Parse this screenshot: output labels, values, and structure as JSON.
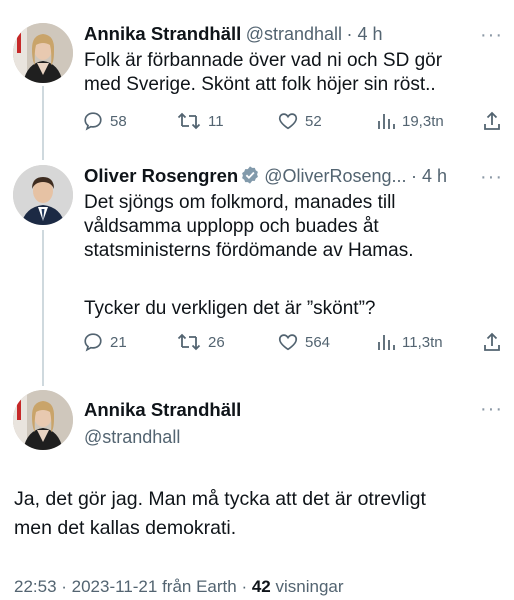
{
  "tweets": [
    {
      "name": "Annika Strandhäll",
      "handle": "@strandhall",
      "time": "· 4 h",
      "text_lines": [
        "Folk är förbannade över vad ni och SD gör",
        "med Sverige. Skönt att folk höjer sin röst.."
      ],
      "replies": "58",
      "retweets": "11",
      "likes": "52",
      "views": "19,3tn"
    },
    {
      "name": "Oliver Rosengren",
      "handle": "@OliverRoseng...",
      "time": "· 4 h",
      "text_lines": [
        "Det sjöngs om folkmord, manades till",
        "våldsamma upplopp och buades åt",
        "statsministerns fördömande av Hamas."
      ],
      "text_lines_2": [
        "Tycker du verkligen det är ”skönt”?"
      ],
      "replies": "21",
      "retweets": "26",
      "likes": "564",
      "views": "11,3tn"
    },
    {
      "name": "Annika Strandhäll",
      "handle": "@strandhall",
      "text_lines": [
        "Ja, det gör jag. Man må tycka att det är otrevligt",
        "men det kallas demokrati."
      ],
      "time_full": "22:53 · 2023-11-21 från Earth ·",
      "views_count": "42",
      "views_label": "visningar"
    }
  ],
  "icons": [
    "more-icon",
    "reply-icon",
    "retweet-icon",
    "like-icon",
    "views-icon",
    "share-icon",
    "verified-icon"
  ],
  "colors": {
    "text": "#0f1419",
    "secondary": "#536471",
    "verified": "#829aab",
    "thread": "#cfd9de"
  }
}
